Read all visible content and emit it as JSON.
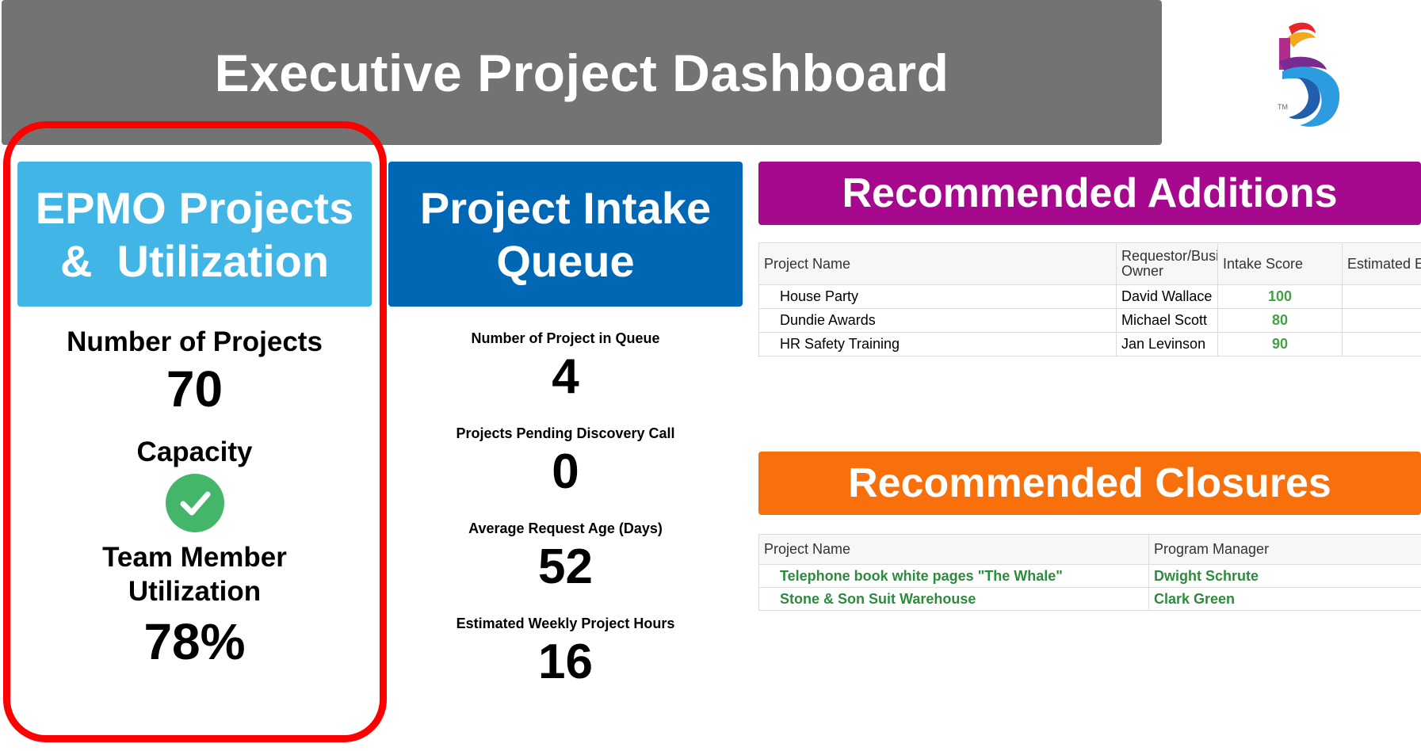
{
  "header": {
    "title": "Executive Project Dashboard"
  },
  "logo": {
    "trademark": "TM"
  },
  "epmo": {
    "title_line1": "EPMO Projects",
    "title_line2": "&  Utilization",
    "num_projects_label": "Number of Projects",
    "num_projects_value": "70",
    "capacity_label": "Capacity",
    "capacity_status_icon": "green-check-icon",
    "utilization_label_line1": "Team Member",
    "utilization_label_line2": "Utilization",
    "utilization_value": "78%"
  },
  "intake": {
    "title_line1": "Project Intake",
    "title_line2": "Queue",
    "metrics": [
      {
        "label": "Number of Project in Queue",
        "value": "4"
      },
      {
        "label": "Projects Pending Discovery Call",
        "value": "0"
      },
      {
        "label": "Average Request Age (Days)",
        "value": "52"
      },
      {
        "label": "Estimated Weekly Project Hours",
        "value": "16"
      }
    ]
  },
  "additions": {
    "title": "Recommended Additions",
    "columns": [
      "Project Name",
      "Requestor/Busi",
      "Owner",
      "Intake Score",
      "Estimated E"
    ],
    "rows": [
      {
        "project": "House Party",
        "owner": "David Wallace",
        "score": "100"
      },
      {
        "project": "Dundie Awards",
        "owner": "Michael Scott",
        "score": "80"
      },
      {
        "project": "HR Safety Training",
        "owner": "Jan Levinson",
        "score": "90"
      }
    ]
  },
  "closures": {
    "title": "Recommended Closures",
    "columns": [
      "Project Name",
      "Program Manager"
    ],
    "rows": [
      {
        "project": "Telephone book white pages \"The Whale\"",
        "manager": "Dwight Schrute"
      },
      {
        "project": "Stone & Son Suit Warehouse",
        "manager": "Clark Green"
      }
    ]
  },
  "colors": {
    "header_gray": "#737373",
    "epmo_blue": "#41b6e6",
    "intake_blue": "#0067b4",
    "additions_magenta": "#a6088e",
    "closures_orange": "#f7700b",
    "highlight_red": "#ff0000",
    "score_green": "#43a047"
  }
}
